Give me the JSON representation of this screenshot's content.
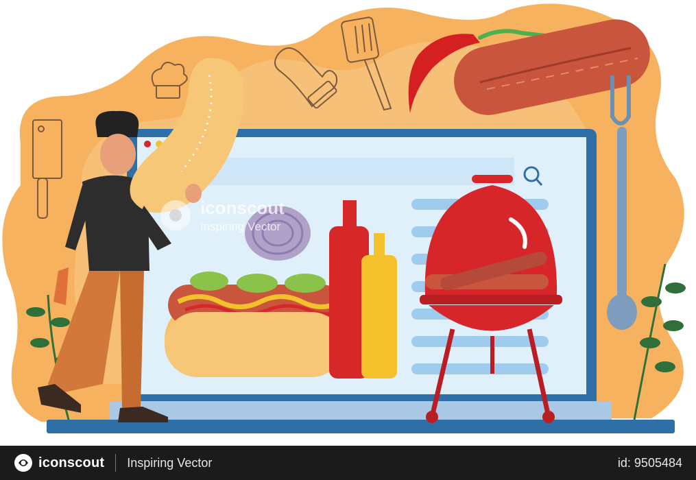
{
  "watermark": {
    "brand": "iconscout",
    "tagline": "Inspiring Vector"
  },
  "footer": {
    "brand": "iconscout",
    "tagline": "Inspiring Vector",
    "id_label": "id: 9505484"
  },
  "colors": {
    "blob": "#f6b25e",
    "blob_light": "#f8c98a",
    "screen_bg": "#dff0fb",
    "monitor_frame": "#2f6fa8",
    "grill_red": "#d7262a",
    "ketchup": "#d62828",
    "mustard": "#f3c12b",
    "footer_bg": "#1b1b1b"
  },
  "icons": [
    "search-icon",
    "cleaver-icon",
    "chef-hat-icon",
    "oven-mitt-icon",
    "spatula-icon",
    "chili-pepper-icon",
    "fork-icon",
    "iconscout-logo-icon"
  ]
}
